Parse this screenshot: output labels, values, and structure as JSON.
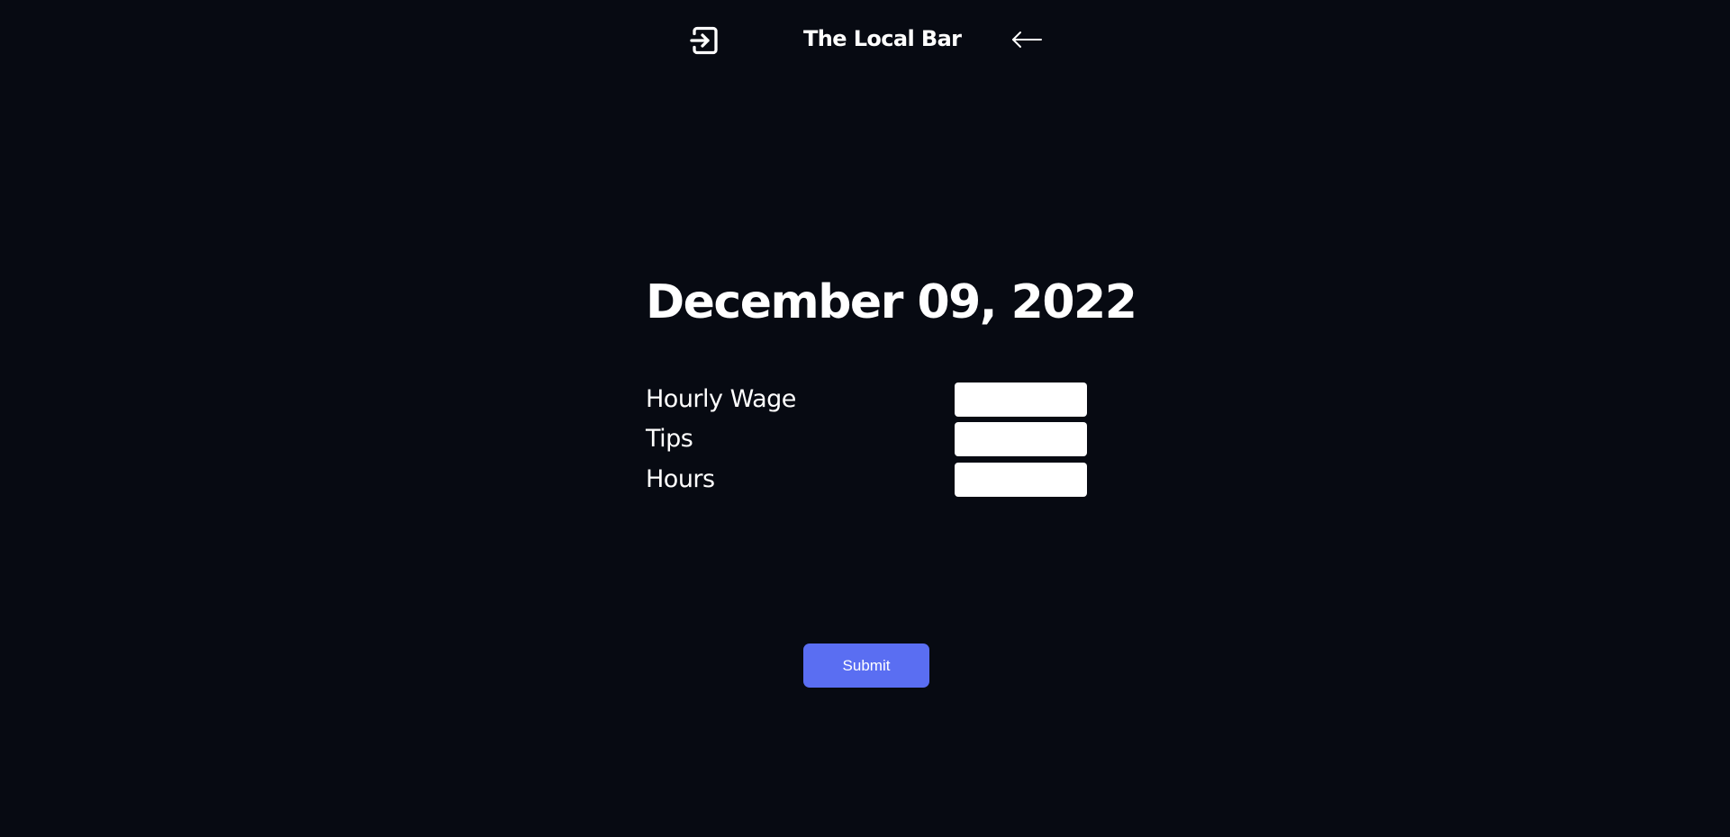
{
  "header": {
    "title": "The Local Bar",
    "logout_icon": "login-arrow-icon",
    "back_icon": "arrow-left-icon"
  },
  "main": {
    "date": "December 09, 2022"
  },
  "form": {
    "fields": [
      {
        "label": "Hourly Wage",
        "value": ""
      },
      {
        "label": "Tips",
        "value": ""
      },
      {
        "label": "Hours",
        "value": ""
      }
    ],
    "submit_label": "Submit"
  },
  "colors": {
    "background": "#070a12",
    "text": "#ffffff",
    "accent": "#5a6ef2",
    "input_bg": "#ffffff"
  }
}
